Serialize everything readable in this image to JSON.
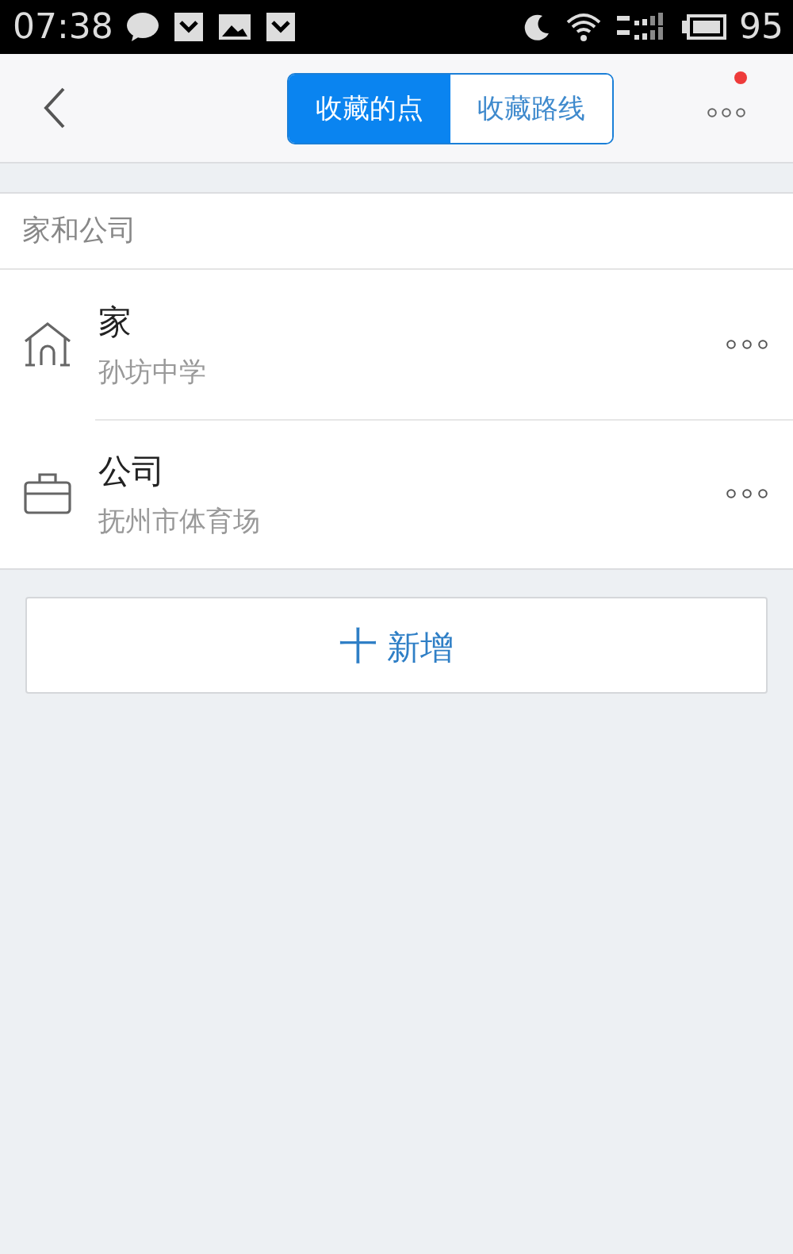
{
  "status_bar": {
    "time": "07:38",
    "battery": "95"
  },
  "nav": {
    "tabs": [
      {
        "label": "收藏的点",
        "selected": true
      },
      {
        "label": "收藏路线",
        "selected": false
      }
    ],
    "menu_badge": true
  },
  "section": {
    "title": "家和公司"
  },
  "places": [
    {
      "kind": "home",
      "name": "家",
      "address": "孙坊中学"
    },
    {
      "kind": "work",
      "name": "公司",
      "address": "抚州市体育场"
    }
  ],
  "add_button": {
    "icon": "十",
    "label": "新增"
  }
}
